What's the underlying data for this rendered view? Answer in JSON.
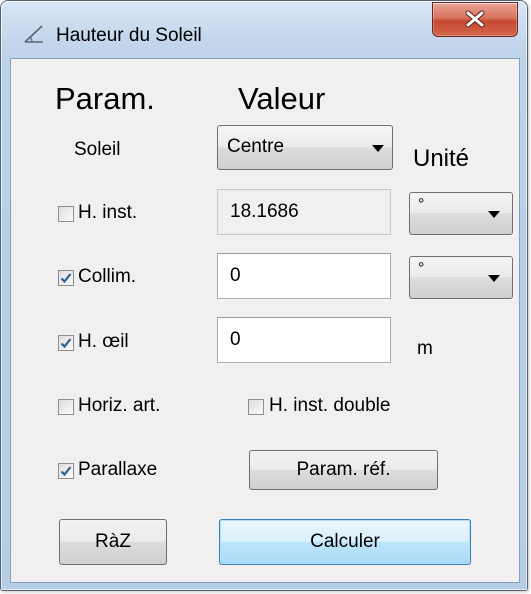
{
  "window": {
    "title": "Hauteur du Soleil",
    "title_icon": "angle-icon",
    "close_icon": "close-icon"
  },
  "headers": {
    "param": "Param.",
    "valeur": "Valeur",
    "unite": "Unité"
  },
  "soleil": {
    "label": "Soleil",
    "selected": "Centre"
  },
  "h_inst": {
    "label": "H. inst.",
    "checked": false,
    "value": "18.1686",
    "unit": "°"
  },
  "collim": {
    "label": "Collim.",
    "checked": true,
    "value": "0",
    "unit": "°"
  },
  "h_oeil": {
    "label": "H. œil",
    "checked": true,
    "value": "0",
    "unit": "m"
  },
  "horiz_art": {
    "label": "Horiz. art.",
    "checked": false
  },
  "h_inst_double": {
    "label": "H. inst. double",
    "checked": false
  },
  "parallaxe": {
    "label": "Parallaxe",
    "checked": true
  },
  "buttons": {
    "param_ref": "Param. réf.",
    "raz": "RàZ",
    "calculer": "Calculer"
  },
  "colors": {
    "check_mark": "#2d5e8f",
    "close_button": "#c44a31",
    "default_button": "#bee6fd"
  }
}
